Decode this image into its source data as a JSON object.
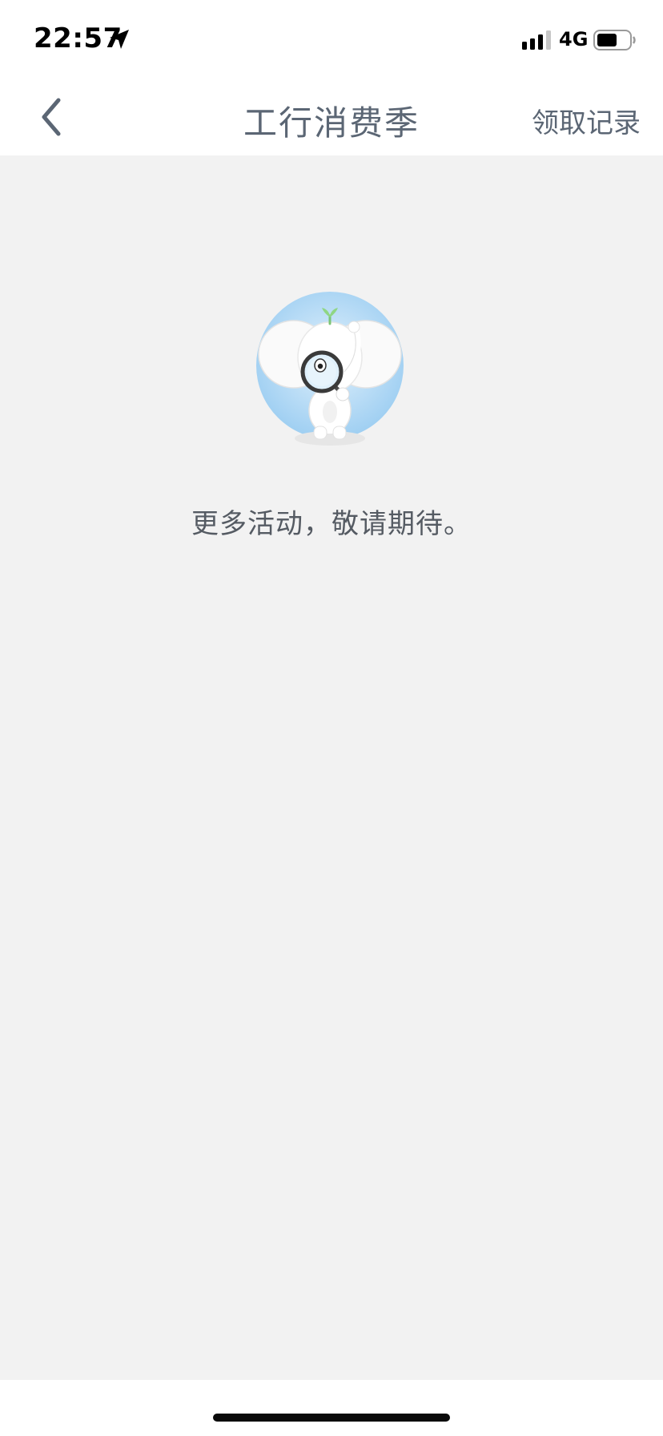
{
  "status_bar": {
    "time": "22:57",
    "network": "4G",
    "icons": [
      "location-arrow-icon",
      "signal-icon",
      "battery-icon"
    ]
  },
  "nav": {
    "back_icon": "chevron-left-icon",
    "title": "工行消费季",
    "records_label": "领取记录"
  },
  "empty_state": {
    "illustration": "elephant-magnifier-illustration",
    "message": "更多活动，敬请期待。"
  },
  "colors": {
    "nav_text": "#5b6674",
    "page_background": "#f2f2f2",
    "illustration_circle": "#a9d4f3"
  }
}
